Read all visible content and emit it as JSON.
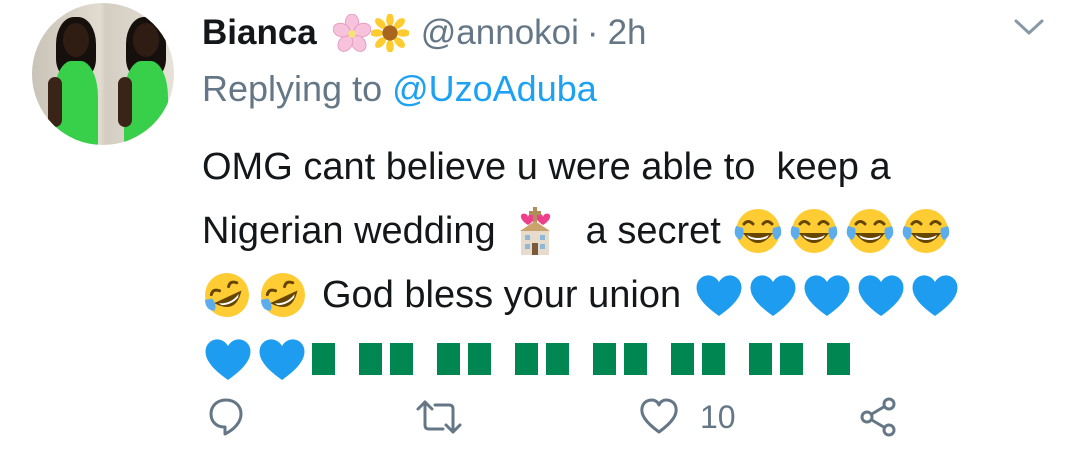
{
  "author": {
    "name": "Bianca",
    "handle": "@annokoi",
    "separator": "·",
    "time": "2h",
    "name_emojis": [
      "cherry-blossom-icon",
      "sunflower-icon"
    ]
  },
  "reply": {
    "prefix": "Replying to ",
    "mention": "@UzoAduba"
  },
  "tweet": {
    "line1": "OMG cant believe u were able to  keep a",
    "line2_a": "Nigerian wedding",
    "line2_b": "a secret",
    "line3": "God bless your union"
  },
  "actions": {
    "like_count": "10"
  },
  "colors": {
    "name": "#14171a",
    "secondary": "#657786",
    "link": "#1da1f2",
    "heart_emoji": "#1e9df0",
    "flag_green": "#008751"
  }
}
